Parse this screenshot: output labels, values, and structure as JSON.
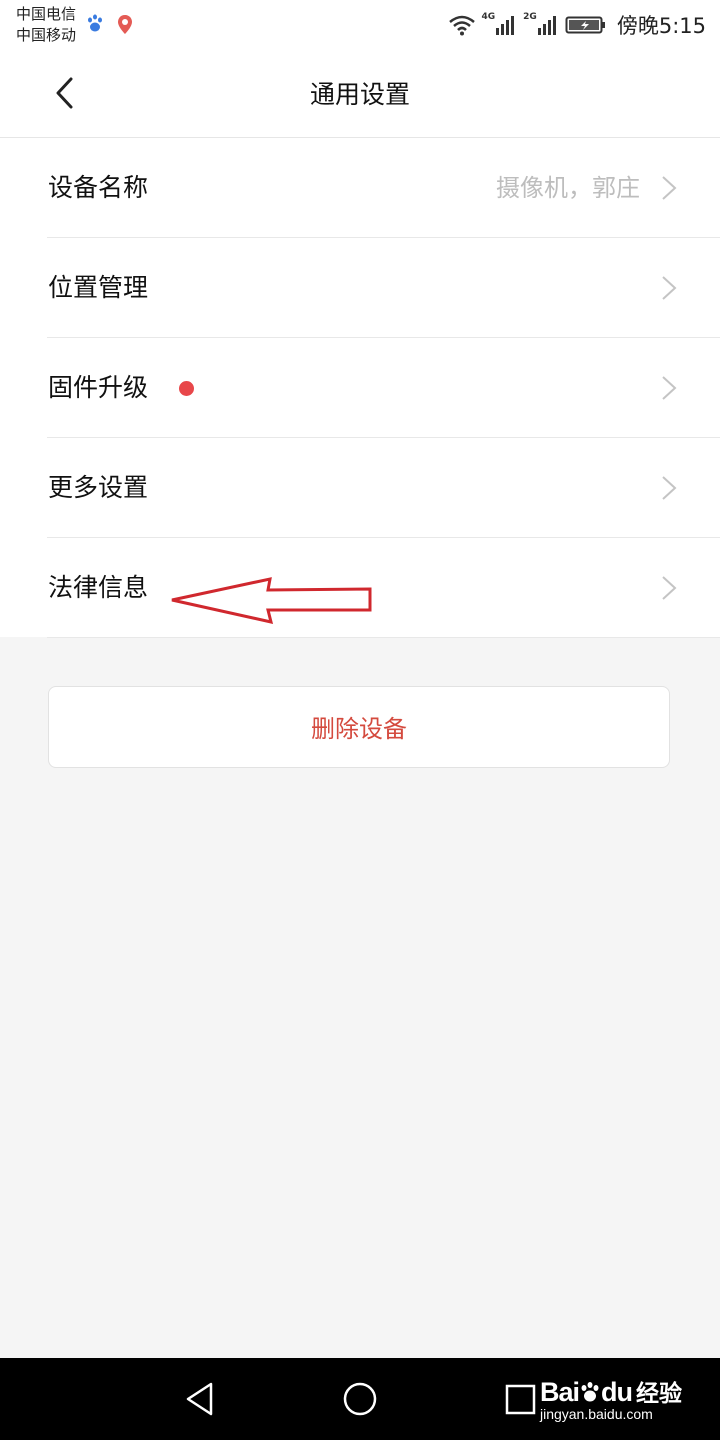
{
  "status_bar": {
    "carrier_1": "中国电信",
    "carrier_2": "中国移动",
    "net_1": "4G",
    "net_2": "2G",
    "time": "傍晚5:15",
    "icons": [
      "baidu-paw-icon",
      "location-pin-icon",
      "wifi-icon",
      "signal-icon",
      "battery-charging-icon"
    ]
  },
  "header": {
    "title": "通用设置",
    "back_icon": "chevron-left-icon"
  },
  "settings": [
    {
      "label": "设备名称",
      "value": "摄像机，郭庄",
      "badge": false
    },
    {
      "label": "位置管理",
      "value": "",
      "badge": false
    },
    {
      "label": "固件升级",
      "value": "",
      "badge": true
    },
    {
      "label": "更多设置",
      "value": "",
      "badge": false
    },
    {
      "label": "法律信息",
      "value": "",
      "badge": false
    }
  ],
  "annotation": {
    "icon": "red-arrow-left-icon",
    "color": "#d0282e"
  },
  "delete_button": {
    "label": "删除设备",
    "color": "#d44a3e"
  },
  "nav_bar": {
    "icons": [
      "back-triangle-icon",
      "home-circle-icon",
      "recents-square-icon"
    ]
  },
  "watermark": {
    "logo": "Bai",
    "logo_suffix": "du",
    "text": "经验",
    "url": "jingyan.baidu.com"
  },
  "colors": {
    "badge": "#e8474a",
    "background": "#f5f5f5"
  }
}
